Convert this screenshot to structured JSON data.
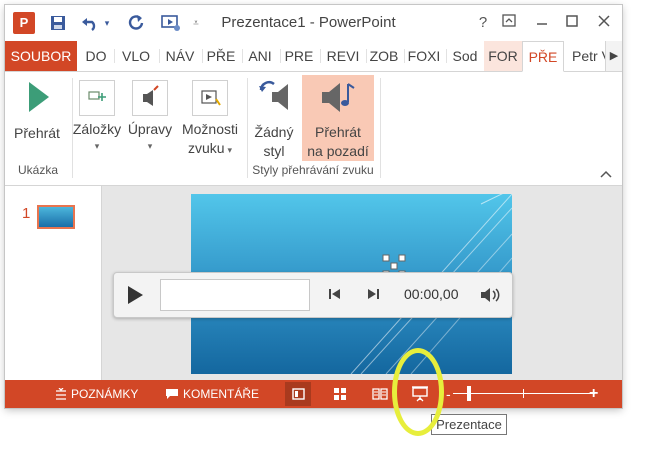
{
  "titlebar": {
    "app_icon_letter": "P",
    "title": "Prezentace1 - PowerPoint",
    "help_glyph": "?",
    "restore_glyph": "⧉"
  },
  "tabs": [
    {
      "label": "SOUBOR"
    },
    {
      "label": "DO"
    },
    {
      "label": "VLO"
    },
    {
      "label": "NÁV"
    },
    {
      "label": "PŘE"
    },
    {
      "label": "ANI"
    },
    {
      "label": "PRE"
    },
    {
      "label": "REVI"
    },
    {
      "label": "ZOB"
    },
    {
      "label": "FOXI"
    },
    {
      "label": "Sod"
    },
    {
      "label": "FOR"
    },
    {
      "label": "PŘE"
    },
    {
      "label": "Petr V"
    }
  ],
  "ribbon": {
    "play_label": "Přehrát",
    "bookmarks_label": "Záložky",
    "edits_label": "Úpravy",
    "audio_options_line1": "Možnosti",
    "audio_options_line2": "zvuku",
    "no_style_line1": "Žádný",
    "no_style_line2": "styl",
    "play_bg_line1": "Přehrát",
    "play_bg_line2": "na pozadí",
    "group_preview": "Ukázka",
    "group_styles": "Styly přehrávání zvuku"
  },
  "slides": {
    "number": "1"
  },
  "player": {
    "time": "00:00,00"
  },
  "statusbar": {
    "notes": "POZNÁMKY",
    "comments": "KOMENTÁŘE",
    "zoom_minus": "-",
    "zoom_plus": "+"
  },
  "tooltip": {
    "text": "Prezentace"
  },
  "colors": {
    "accent": "#d24726",
    "annotation": "#e7ee3c"
  }
}
